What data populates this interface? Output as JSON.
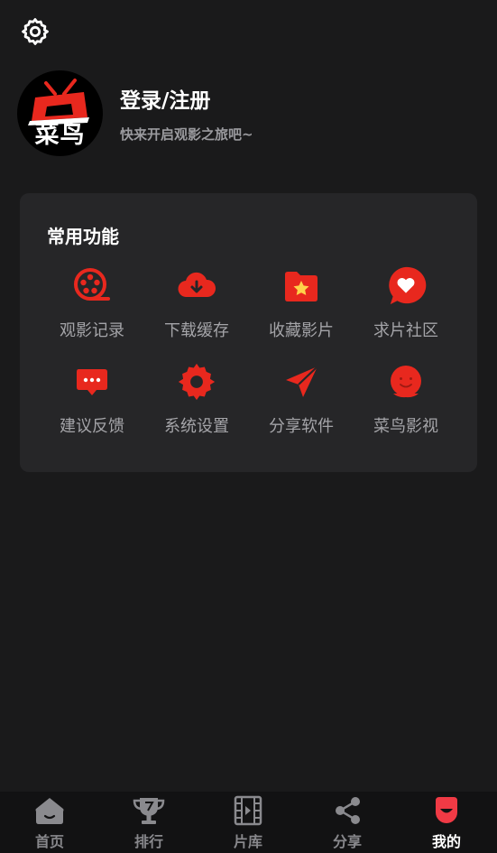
{
  "profile": {
    "avatar_text": "菜鸟",
    "title": "登录/注册",
    "subtitle": "快来开启观影之旅吧~"
  },
  "common": {
    "title": "常用功能",
    "items": [
      {
        "label": "观影记录",
        "icon": "film-reel-icon"
      },
      {
        "label": "下载缓存",
        "icon": "cloud-download-icon"
      },
      {
        "label": "收藏影片",
        "icon": "star-folder-icon"
      },
      {
        "label": "求片社区",
        "icon": "heart-bubble-icon"
      },
      {
        "label": "建议反馈",
        "icon": "chat-bubble-icon"
      },
      {
        "label": "系统设置",
        "icon": "gear-icon"
      },
      {
        "label": "分享软件",
        "icon": "send-icon"
      },
      {
        "label": "菜鸟影视",
        "icon": "smiley-icon"
      }
    ]
  },
  "tabs": [
    {
      "label": "首页",
      "icon": "home-icon",
      "active": false
    },
    {
      "label": "排行",
      "icon": "trophy-icon",
      "active": false
    },
    {
      "label": "片库",
      "icon": "film-strip-icon",
      "active": false
    },
    {
      "label": "分享",
      "icon": "share-icon",
      "active": false
    },
    {
      "label": "我的",
      "icon": "profile-face-icon",
      "active": true
    }
  ],
  "colors": {
    "accent": "#e8281e",
    "background": "#1a1a1b",
    "card": "#262628",
    "tabbar": "#121213"
  }
}
